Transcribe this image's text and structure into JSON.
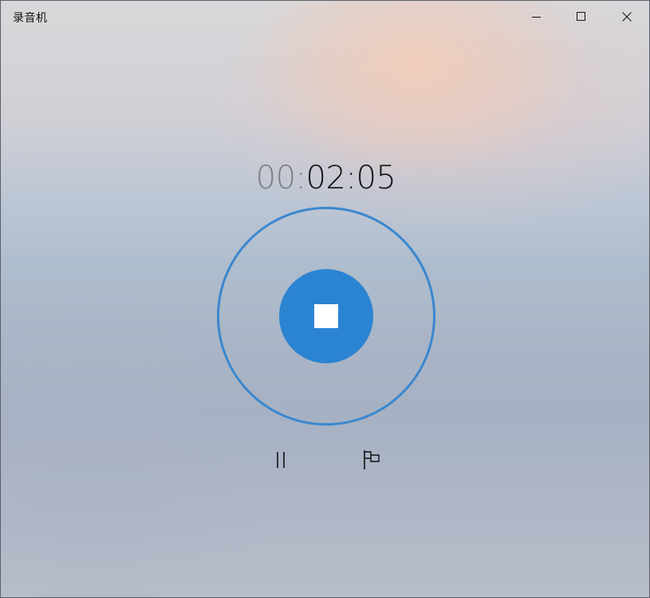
{
  "window": {
    "title": "录音机",
    "controls": {
      "minimize_icon": "minimize-icon",
      "maximize_icon": "maximize-icon",
      "close_icon": "close-icon"
    }
  },
  "timer": {
    "hours": "00",
    "separator1": ":",
    "minutes": "02",
    "separator2": ":",
    "seconds": "05"
  },
  "controls": {
    "stop_icon": "stop-icon",
    "pause_icon": "pause-icon",
    "marker_icon": "flag-icon"
  },
  "colors": {
    "accent": "#2b84d2",
    "ring": "#3a87cf",
    "timer_dim": "#7e7f84",
    "timer_bright": "#121316"
  }
}
